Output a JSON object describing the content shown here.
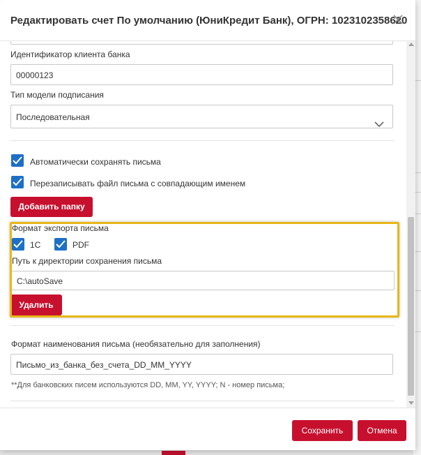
{
  "dialog": {
    "title": "Редактировать счет По умолчанию (ЮниКредит Банк), ОГРН: 1023102358620",
    "close_icon": "close-icon"
  },
  "fields": {
    "client_id_label": "Идентификатор клиента банка",
    "client_id_value": "00000123",
    "sign_model_label": "Тип модели подписания",
    "sign_model_value": "Последовательная"
  },
  "checkboxes": {
    "auto_save_label": "Автоматически сохранять письма",
    "auto_save_checked": true,
    "overwrite_label": "Перезаписывать файл письма с совпадающим именем",
    "overwrite_checked": true
  },
  "add_folder_button": "Добавить папку",
  "export": {
    "format_label": "Формат экспорта письма",
    "format_1c": "1С",
    "format_1c_checked": true,
    "format_pdf": "PDF",
    "format_pdf_checked": true,
    "path_label": "Путь к директории сохранения письма",
    "path_value": "C:\\autoSave",
    "delete_button": "Удалить"
  },
  "name_format": {
    "label": "Формат наименования письма (необязательно для заполнения)",
    "value": "Письмо_из_банка_без_счета_DD_MM_YYYY",
    "hint": "**Для банковских писем используются DD, MM, YY, YYYY; N - номер письма;"
  },
  "footer": {
    "save_button": "Сохранить",
    "cancel_button": "Отмена"
  },
  "colors": {
    "accent_red": "#c7102e",
    "checkbox_blue": "#1e6fc6",
    "highlight_yellow": "#e8b71a"
  }
}
